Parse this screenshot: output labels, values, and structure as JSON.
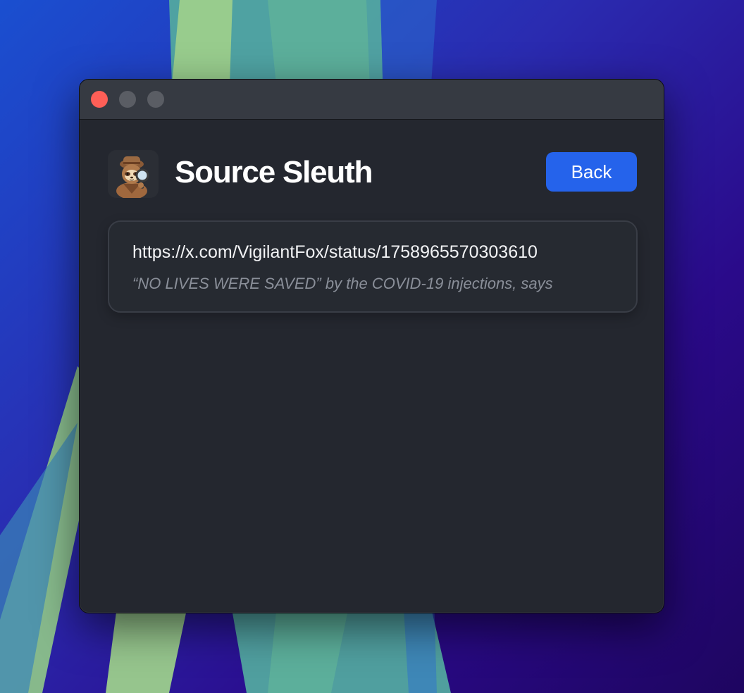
{
  "app": {
    "title": "Source Sleuth",
    "icon": "sloth-detective-icon"
  },
  "header": {
    "back_label": "Back",
    "accent_color": "#2563eb"
  },
  "window_controls": {
    "close_color": "#ff5f57",
    "inactive_color": "#5a5d64"
  },
  "sources": [
    {
      "url": "https://x.com/VigilantFox/status/1758965570303610",
      "snippet": "“NO LIVES WERE SAVED” by the COVID-19 injections, says"
    }
  ]
}
